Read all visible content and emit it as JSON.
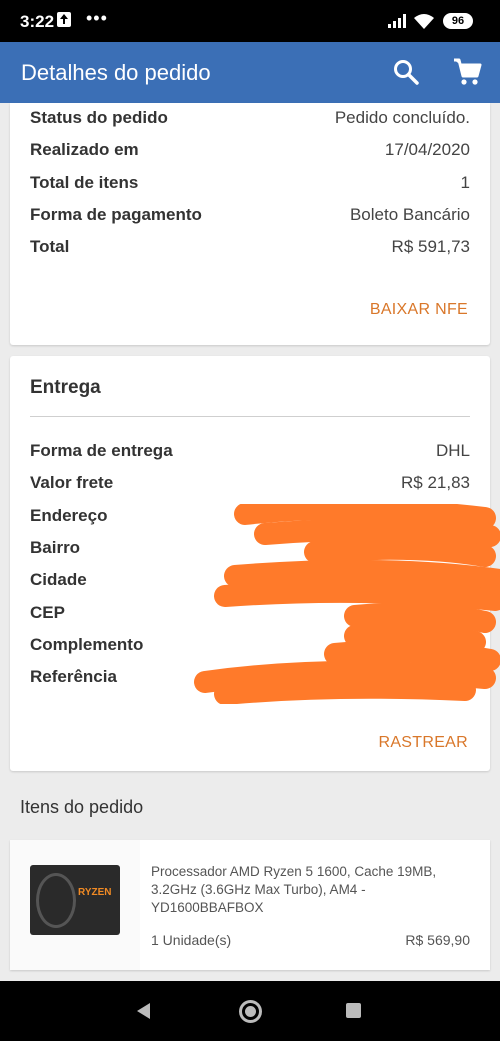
{
  "status_bar": {
    "time": "3:22",
    "more": "•••",
    "battery": "96"
  },
  "app_bar": {
    "title": "Detalhes do pedido",
    "search_icon": "search-icon",
    "cart_icon": "shopping-cart-icon"
  },
  "order": {
    "rows": [
      {
        "label": "Status do pedido",
        "value": "Pedido concluído."
      },
      {
        "label": "Realizado em",
        "value": "17/04/2020"
      },
      {
        "label": "Total de itens",
        "value": "1"
      },
      {
        "label": "Forma de pagamento",
        "value": "Boleto Bancário"
      },
      {
        "label": "Total",
        "value": "R$ 591,73"
      }
    ],
    "action": "BAIXAR NFE"
  },
  "delivery": {
    "title": "Entrega",
    "rows": [
      {
        "label": "Forma de entrega",
        "value": "DHL"
      },
      {
        "label": "Valor frete",
        "value": "R$ 21,83"
      },
      {
        "label": "Endereço",
        "value": ""
      },
      {
        "label": "Bairro",
        "value": ""
      },
      {
        "label": "Cidade",
        "value": ""
      },
      {
        "label": "CEP",
        "value": ""
      },
      {
        "label": "Complemento",
        "value": ""
      },
      {
        "label": "Referência",
        "value": ""
      }
    ],
    "action": "RASTREAR"
  },
  "items_section": {
    "title": "Itens do pedido",
    "items": [
      {
        "description": "Processador AMD Ryzen 5 1600, Cache 19MB, 3.2GHz (3.6GHz Max Turbo), AM4 - YD1600BBAFBOX",
        "quantity": "1 Unidade(s)",
        "price": "R$ 569,90",
        "thumb_logo": "RYZEN"
      }
    ]
  },
  "colors": {
    "app_bar": "#3b6fb6",
    "action": "#d9772a",
    "redaction": "#ff7a2a"
  }
}
